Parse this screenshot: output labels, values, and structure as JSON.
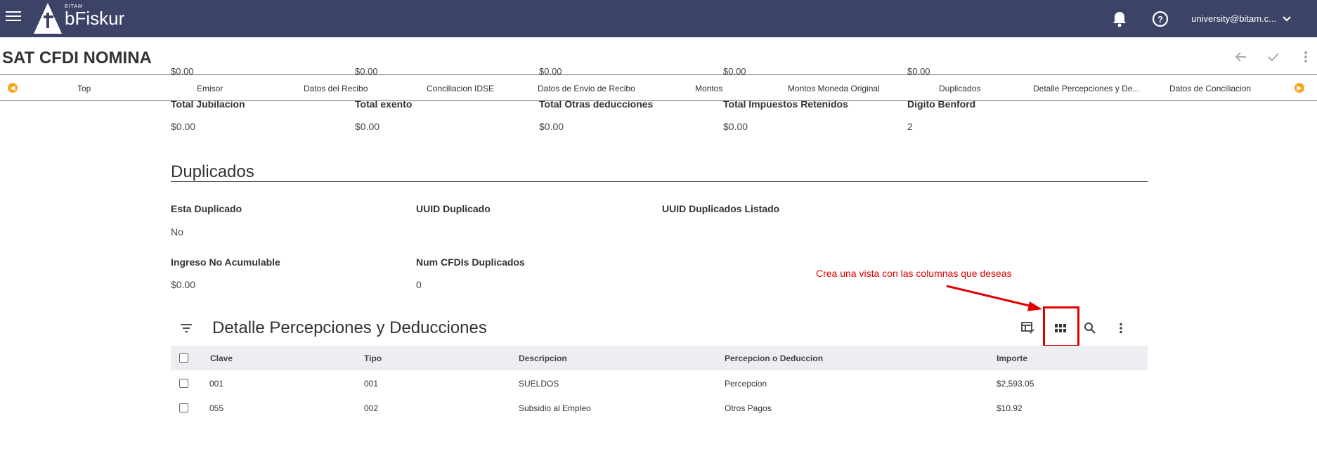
{
  "header": {
    "brand_small": "BITAM",
    "brand_name": "bFiskur",
    "user_email": "university@bitam.c..."
  },
  "page": {
    "title": "SAT CFDI NOMINA"
  },
  "ghost_values": [
    "$0.00",
    "$0.00",
    "$0.00",
    "$0.00",
    "$0.00"
  ],
  "section_nav": {
    "items": [
      "Top",
      "Emisor",
      "Datos del Recibo",
      "Conciliacion IDSE",
      "Datos de Envio de Recibo",
      "Montos",
      "Montos Moneda Original",
      "Duplicados",
      "Detalle Percepciones y De...",
      "Datos de Conciliacion"
    ]
  },
  "montos_tail": {
    "fields": [
      {
        "label": "Total Jubilacion",
        "value": "$0.00"
      },
      {
        "label": "Total exento",
        "value": "$0.00"
      },
      {
        "label": "Total Otras deducciones",
        "value": "$0.00"
      },
      {
        "label": "Total Impuestos Retenidos",
        "value": "$0.00"
      },
      {
        "label": "Digito Benford",
        "value": "2"
      }
    ]
  },
  "duplicados": {
    "heading": "Duplicados",
    "fields": [
      {
        "label": "Esta Duplicado",
        "value": "No"
      },
      {
        "label": "UUID Duplicado",
        "value": ""
      },
      {
        "label": "UUID Duplicados Listado",
        "value": ""
      },
      {
        "label": "Ingreso No Acumulable",
        "value": "$0.00"
      },
      {
        "label": "Num CFDIs Duplicados",
        "value": "0"
      }
    ]
  },
  "annotation": {
    "text": "Crea una vista con las columnas que deseas",
    "color": "#e00000"
  },
  "grid": {
    "title": "Detalle Percepciones y Deducciones",
    "columns": [
      "Clave",
      "Tipo",
      "Descripcion",
      "Percepcion o Deduccion",
      "Importe"
    ],
    "rows": [
      [
        "001",
        "001",
        "SUELDOS",
        "Percepcion",
        "$2,593.05"
      ],
      [
        "055",
        "002",
        "Subsidio al Empleo",
        "Otros Pagos",
        "$10.92"
      ]
    ]
  },
  "colors": {
    "topbar": "#3d4366",
    "accent_orange": "#f5a623",
    "table_header_bg": "#eceef1"
  }
}
